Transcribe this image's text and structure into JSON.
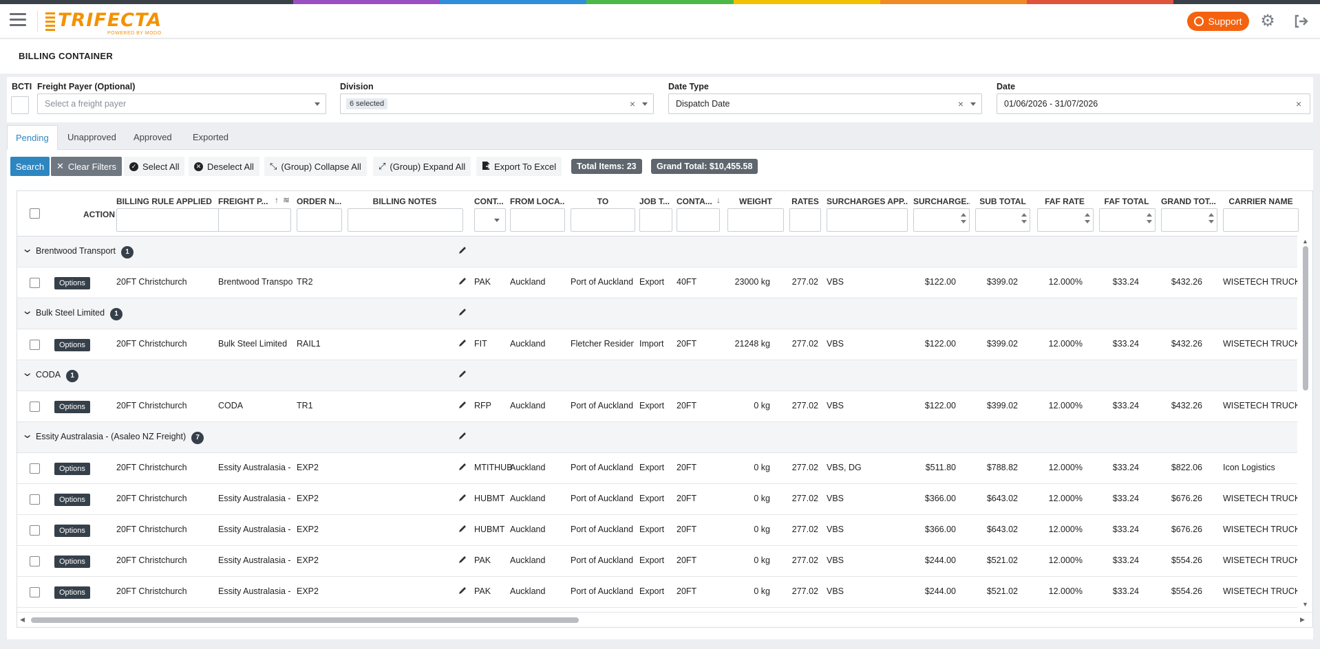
{
  "colors": {
    "brand": "#f39200",
    "support": "#f5620f",
    "primary": "#2e86c1",
    "stripe": [
      "#3a4048",
      "#3a4048",
      "#9b4fc0",
      "#2f8fd8",
      "#4cb848",
      "#f2c200",
      "#f08a24",
      "#e0533c",
      "#3a4048"
    ]
  },
  "header": {
    "logo_text": "TRIFECTA",
    "logo_sub": "POWERED BY MODO",
    "support_label": "Support"
  },
  "page": {
    "title": "BILLING CONTAINER"
  },
  "filters": {
    "bcti_label": "BCTI",
    "freight_payer_label": "Freight Payer (Optional)",
    "freight_payer_placeholder": "Select a freight payer",
    "division_label": "Division",
    "division_value": "6 selected",
    "date_type_label": "Date Type",
    "date_type_value": "Dispatch Date",
    "date_label": "Date",
    "date_value": "01/06/2026 - 31/07/2026"
  },
  "tabs": [
    "Pending",
    "Unapproved",
    "Approved",
    "Exported"
  ],
  "toolbar": {
    "search": "Search",
    "clear_filters": "Clear Filters",
    "select_all": "Select All",
    "deselect_all": "Deselect All",
    "collapse_all": "(Group) Collapse All",
    "expand_all": "(Group) Expand All",
    "export": "Export To Excel",
    "total_items": "Total Items: 23",
    "grand_total": "Grand Total: $10,455.58"
  },
  "grid": {
    "columns": [
      "ACTION",
      "BILLING RULE APPLIED",
      "FREIGHT P...",
      "ORDER N...",
      "BILLING NOTES",
      "CONT...",
      "FROM LOCA...",
      "TO",
      "JOB T...",
      "CONTA...",
      "WEIGHT",
      "RATES",
      "SURCHARGES APP...",
      "SURCHARGE...",
      "SUB TOTAL",
      "FAF RATE",
      "FAF TOTAL",
      "GRAND TOT...",
      "CARRIER NAME"
    ],
    "option_label": "Options",
    "rows": [
      {
        "type": "group",
        "name": "Brentwood Transport",
        "count": "1"
      },
      {
        "type": "data",
        "rule": "20FT Christchurch",
        "payer": "Brentwood Transpo",
        "order": "TR2",
        "cont": "PAK",
        "from": "Auckland",
        "to": "Port of Auckland",
        "job": "Export",
        "ctype": "40FT",
        "weight": "23000 kg",
        "rates": "277.02",
        "surch_app": "VBS",
        "surch": "$122.00",
        "sub": "$399.02",
        "faf_rate": "12.000%",
        "faf_total": "$33.24",
        "grand": "$432.26",
        "carrier": "WISETECH TRUCKER"
      },
      {
        "type": "group",
        "name": "Bulk Steel Limited",
        "count": "1"
      },
      {
        "type": "data",
        "rule": "20FT Christchurch",
        "payer": "Bulk Steel Limited",
        "order": "RAIL1",
        "cont": "FIT",
        "from": "Auckland",
        "to": "Fletcher Residenti",
        "job": "Import",
        "ctype": "20FT",
        "weight": "21248 kg",
        "rates": "277.02",
        "surch_app": "VBS",
        "surch": "$122.00",
        "sub": "$399.02",
        "faf_rate": "12.000%",
        "faf_total": "$33.24",
        "grand": "$432.26",
        "carrier": "WISETECH TRUCKER"
      },
      {
        "type": "group",
        "name": "CODA",
        "count": "1"
      },
      {
        "type": "data",
        "rule": "20FT Christchurch",
        "payer": "CODA",
        "order": "TR1",
        "cont": "RFP",
        "from": "Auckland",
        "to": "Port of Auckland",
        "job": "Export",
        "ctype": "20FT",
        "weight": "0 kg",
        "rates": "277.02",
        "surch_app": "VBS",
        "surch": "$122.00",
        "sub": "$399.02",
        "faf_rate": "12.000%",
        "faf_total": "$33.24",
        "grand": "$432.26",
        "carrier": "WISETECH TRUCKER"
      },
      {
        "type": "group",
        "name": "Essity Australasia - (Asaleo NZ Freight)",
        "count": "7"
      },
      {
        "type": "data",
        "rule": "20FT Christchurch",
        "payer": "Essity Australasia - (.",
        "order": "EXP2",
        "cont": "MTITHUB",
        "from": "Auckland",
        "to": "Port of Auckland",
        "job": "Export",
        "ctype": "20FT",
        "weight": "0 kg",
        "rates": "277.02",
        "surch_app": "VBS, DG",
        "surch": "$511.80",
        "sub": "$788.82",
        "faf_rate": "12.000%",
        "faf_total": "$33.24",
        "grand": "$822.06",
        "carrier": "Icon Logistics"
      },
      {
        "type": "data",
        "rule": "20FT Christchurch",
        "payer": "Essity Australasia - (.",
        "order": "EXP2",
        "cont": "HUBMT",
        "from": "Auckland",
        "to": "Port of Auckland",
        "job": "Export",
        "ctype": "20FT",
        "weight": "0 kg",
        "rates": "277.02",
        "surch_app": "VBS",
        "surch": "$366.00",
        "sub": "$643.02",
        "faf_rate": "12.000%",
        "faf_total": "$33.24",
        "grand": "$676.26",
        "carrier": "WISETECH TRUCKER"
      },
      {
        "type": "data",
        "rule": "20FT Christchurch",
        "payer": "Essity Australasia - (.",
        "order": "EXP2",
        "cont": "HUBMT",
        "from": "Auckland",
        "to": "Port of Auckland",
        "job": "Export",
        "ctype": "20FT",
        "weight": "0 kg",
        "rates": "277.02",
        "surch_app": "VBS",
        "surch": "$366.00",
        "sub": "$643.02",
        "faf_rate": "12.000%",
        "faf_total": "$33.24",
        "grand": "$676.26",
        "carrier": "WISETECH TRUCKER"
      },
      {
        "type": "data",
        "rule": "20FT Christchurch",
        "payer": "Essity Australasia - (.",
        "order": "EXP2",
        "cont": "PAK",
        "from": "Auckland",
        "to": "Port of Auckland",
        "job": "Export",
        "ctype": "20FT",
        "weight": "0 kg",
        "rates": "277.02",
        "surch_app": "VBS",
        "surch": "$244.00",
        "sub": "$521.02",
        "faf_rate": "12.000%",
        "faf_total": "$33.24",
        "grand": "$554.26",
        "carrier": "WISETECH TRUCKER"
      },
      {
        "type": "data",
        "rule": "20FT Christchurch",
        "payer": "Essity Australasia - (.",
        "order": "EXP2",
        "cont": "PAK",
        "from": "Auckland",
        "to": "Port of Auckland",
        "job": "Export",
        "ctype": "20FT",
        "weight": "0 kg",
        "rates": "277.02",
        "surch_app": "VBS",
        "surch": "$244.00",
        "sub": "$521.02",
        "faf_rate": "12.000%",
        "faf_total": "$33.24",
        "grand": "$554.26",
        "carrier": "WISETECH TRUCKER"
      }
    ]
  }
}
